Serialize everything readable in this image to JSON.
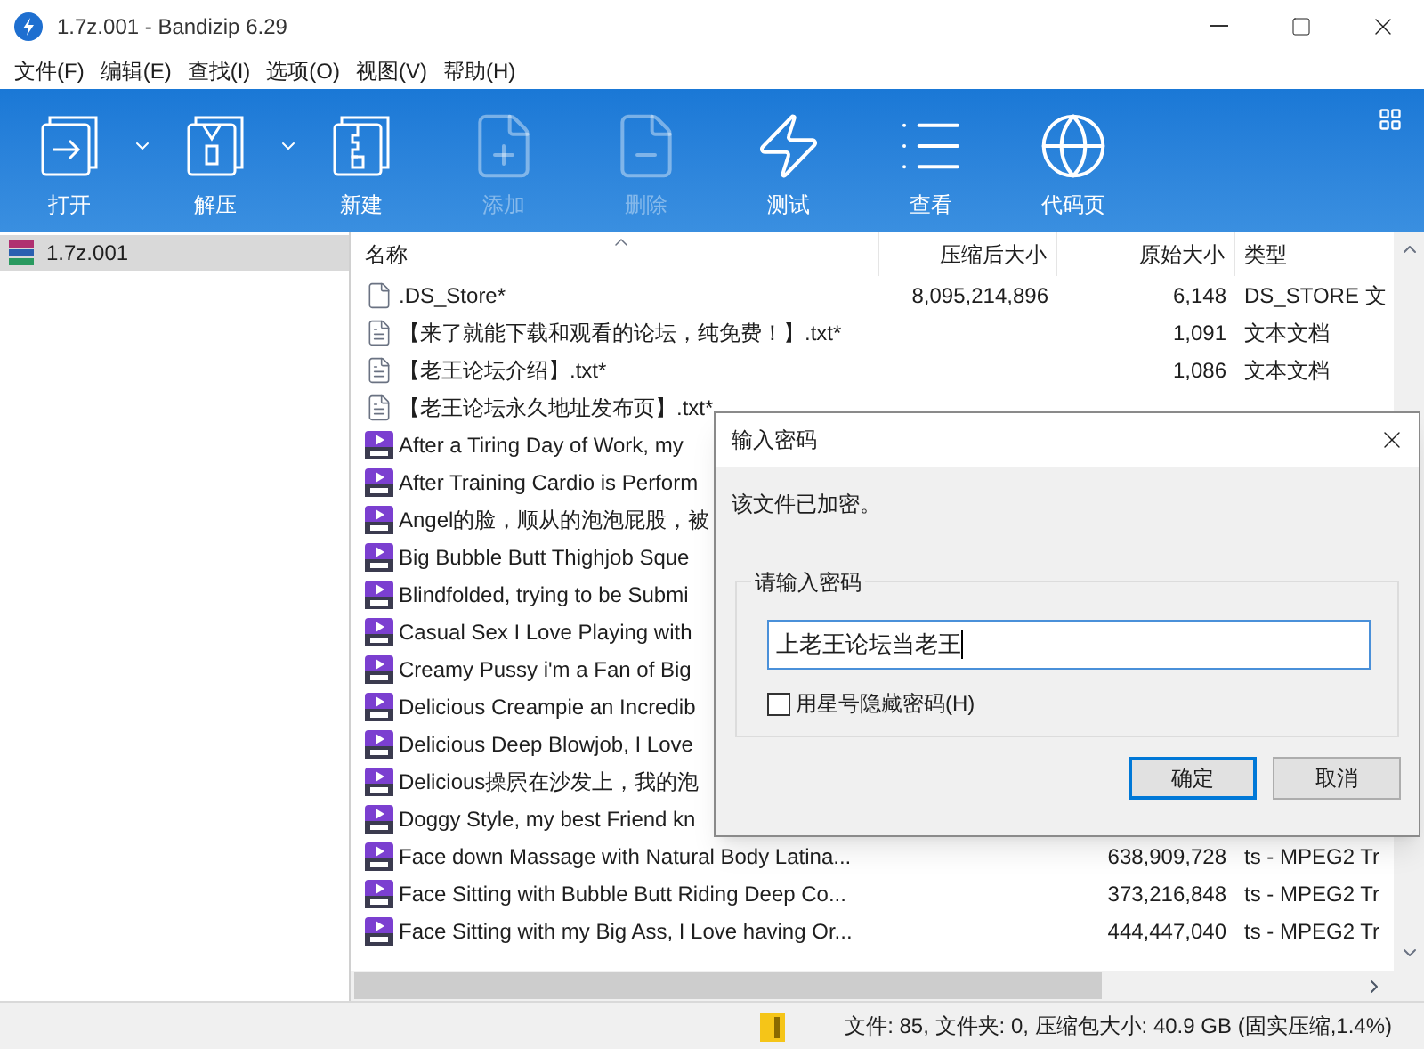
{
  "window": {
    "title": "1.7z.001 - Bandizip 6.29"
  },
  "menu": [
    "文件(F)",
    "编辑(E)",
    "查找(I)",
    "选项(O)",
    "视图(V)",
    "帮助(H)"
  ],
  "toolbar": [
    {
      "kind": "open",
      "label": "打开",
      "has_menu": true,
      "disabled": false
    },
    {
      "kind": "extract",
      "label": "解压",
      "has_menu": true,
      "disabled": false
    },
    {
      "kind": "new",
      "label": "新建",
      "has_menu": false,
      "disabled": false
    },
    {
      "kind": "add",
      "label": "添加",
      "has_menu": false,
      "disabled": true
    },
    {
      "kind": "delete",
      "label": "删除",
      "has_menu": false,
      "disabled": true
    },
    {
      "kind": "test",
      "label": "测试",
      "has_menu": false,
      "disabled": false
    },
    {
      "kind": "view",
      "label": "查看",
      "has_menu": false,
      "disabled": false
    },
    {
      "kind": "codepage",
      "label": "代码页",
      "has_menu": false,
      "disabled": false
    }
  ],
  "tree": [
    {
      "label": "1.7z.001",
      "selected": true
    }
  ],
  "table": {
    "columns": [
      "名称",
      "压缩后大小",
      "原始大小",
      "类型"
    ],
    "rows": [
      {
        "kind": "file",
        "name": ".DS_Store*",
        "packed": "8,095,214,896",
        "size": "6,148",
        "type": "DS_STORE 文"
      },
      {
        "kind": "text",
        "name": "【来了就能下载和观看的论坛，纯免费！】.txt*",
        "size": "1,091",
        "type": "文本文档"
      },
      {
        "kind": "text",
        "name": "【老王论坛介绍】.txt*",
        "size": "1,086",
        "type": "文本文档"
      },
      {
        "kind": "text",
        "name": "【老王论坛永久地址发布页】.txt*"
      },
      {
        "kind": "video",
        "name": "After a Tiring Day of Work, my"
      },
      {
        "kind": "video",
        "name": "After Training Cardio is Perform"
      },
      {
        "kind": "video",
        "name": "Angel的脸，顺从的泡泡屁股，被"
      },
      {
        "kind": "video",
        "name": "Big Bubble Butt Thighjob Sque"
      },
      {
        "kind": "video",
        "name": "Blindfolded, trying to be Submi"
      },
      {
        "kind": "video",
        "name": "Casual Sex I Love Playing with"
      },
      {
        "kind": "video",
        "name": "Creamy Pussy i'm a Fan of Big"
      },
      {
        "kind": "video",
        "name": "Delicious Creampie an Incredib"
      },
      {
        "kind": "video",
        "name": "Delicious Deep Blowjob, I Love"
      },
      {
        "kind": "video",
        "name": "Delicious操屄在沙发上，我的泡"
      },
      {
        "kind": "video",
        "name": "Doggy Style, my best Friend kn"
      },
      {
        "kind": "video",
        "name": "Face down Massage with Natural Body Latina...",
        "size": "638,909,728",
        "type": "ts - MPEG2 Tr"
      },
      {
        "kind": "video",
        "name": "Face Sitting with Bubble Butt Riding Deep Co...",
        "size": "373,216,848",
        "type": "ts - MPEG2 Tr"
      },
      {
        "kind": "video",
        "name": "Face Sitting with my Big Ass, I Love having Or...",
        "size": "444,447,040",
        "type": "ts - MPEG2 Tr"
      }
    ]
  },
  "dialog": {
    "title": "输入密码",
    "message": "该文件已加密。",
    "group": "请输入密码",
    "value": "上老王论坛当老王",
    "checkbox": {
      "label": "用星号隐藏密码(H)",
      "checked": false
    },
    "buttons": [
      {
        "label": "确定",
        "default": true
      },
      {
        "label": "取消",
        "default": false
      }
    ]
  },
  "status_bar": "文件: 85, 文件夹: 0, 压缩包大小: 40.9 GB (固实压缩,1.4%)"
}
